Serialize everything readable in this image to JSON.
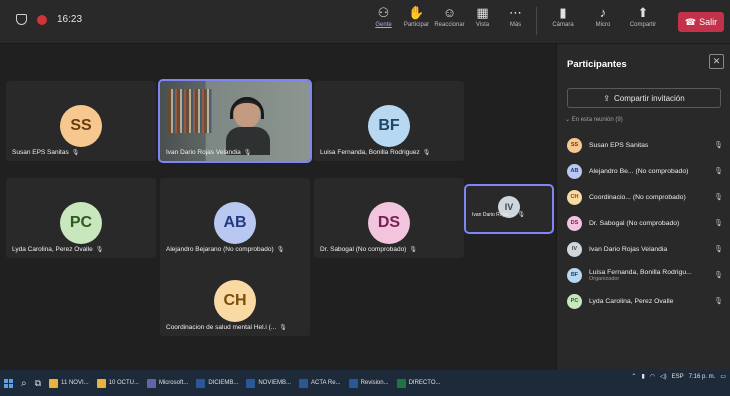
{
  "topbar": {
    "time": "16:23",
    "tools": [
      {
        "icon": "people-icon",
        "label": "Gente",
        "active": true,
        "glyph": "⚇"
      },
      {
        "icon": "raise-hand-icon",
        "label": "Participar",
        "glyph": "✋"
      },
      {
        "icon": "react-icon",
        "label": "Reaccionar",
        "glyph": "☺"
      },
      {
        "icon": "view-icon",
        "label": "Vista",
        "glyph": "▦"
      },
      {
        "icon": "more-icon",
        "label": "Más",
        "glyph": "⋯"
      }
    ],
    "devices": [
      {
        "icon": "camera-icon",
        "label": "Cámara",
        "glyph": "▮"
      },
      {
        "icon": "mic-icon",
        "label": "Micro",
        "glyph": "♪"
      },
      {
        "icon": "share-icon",
        "label": "Compartir",
        "glyph": "⬆"
      }
    ],
    "leave_label": "Salir"
  },
  "tiles": [
    {
      "initials": "SS",
      "name": "Susan EPS Sanitas",
      "color": "#f6c88f",
      "fg": "#6b3c0c"
    },
    {
      "video": true,
      "name": "Ivan Dario Rojas Velandia"
    },
    {
      "initials": "BF",
      "name": "Luisa Fernanda, Bonilla Rodriguez",
      "color": "#b8d7f0",
      "fg": "#1d4766"
    },
    {
      "initials": "PC",
      "name": "Lyda Carolina, Perez Ovalle",
      "color": "#c9e7bd",
      "fg": "#2f5a20"
    },
    {
      "initials": "AB",
      "name": "Alejandro Bejarano (No comprobado)",
      "color": "#b9c8f0",
      "fg": "#233a80"
    },
    {
      "initials": "DS",
      "name": "Dr. Sabogal (No comprobado)",
      "color": "#f2c4dd",
      "fg": "#7a2153"
    },
    {
      "initials": "CH",
      "name": "Coordinacion de salud mental Hel.i (...",
      "color": "#f9d9a4",
      "fg": "#7a4e07"
    },
    {
      "initials": "IV",
      "name": "Ivan Dario Rojas ...",
      "color": "#cfd6dc",
      "fg": "#394650"
    }
  ],
  "panel": {
    "title": "Participantes",
    "invite_label": "Compartir invitación",
    "section_label": "En esta reunión (9)",
    "participants": [
      {
        "initials": "SS",
        "name": "Susan EPS Sanitas",
        "color": "#f6c88f",
        "fg": "#6b3c0c"
      },
      {
        "initials": "AB",
        "name": "Alejandro Be... (No comprobado)",
        "color": "#b9c8f0",
        "fg": "#233a80"
      },
      {
        "initials": "CH",
        "name": "Coordinacio... (No comprobado)",
        "color": "#f9d9a4",
        "fg": "#7a4e07"
      },
      {
        "initials": "DS",
        "name": "Dr. Sabogal (No comprobado)",
        "color": "#f2c4dd",
        "fg": "#7a2153"
      },
      {
        "initials": "IV",
        "name": "Ivan Dario Rojas Velandia",
        "color": "#cfd6dc",
        "fg": "#394650"
      },
      {
        "initials": "BF",
        "name": "Luisa Fernanda, Bonilla Rodrigu...",
        "sub": "Organizador",
        "color": "#b8d7f0",
        "fg": "#1d4766"
      },
      {
        "initials": "PC",
        "name": "Lyda Carolina, Perez Ovalle",
        "color": "#c9e7bd",
        "fg": "#2f5a20"
      }
    ]
  },
  "taskbar": {
    "items": [
      {
        "label": "11 NOVI...",
        "color": "#e8b43a"
      },
      {
        "label": "10 OCTU...",
        "color": "#e8b43a"
      },
      {
        "label": "Microsoft...",
        "color": "#6264a7"
      },
      {
        "label": "DICIEMB...",
        "color": "#2b5797"
      },
      {
        "label": "NOVIEMB...",
        "color": "#2b5797"
      },
      {
        "label": "ACTA Re...",
        "color": "#2b5797"
      },
      {
        "label": "Revision...",
        "color": "#2b5797"
      },
      {
        "label": "DIRECTO...",
        "color": "#217346"
      }
    ],
    "lang": "ESP",
    "clock": "7:16 p. m."
  }
}
